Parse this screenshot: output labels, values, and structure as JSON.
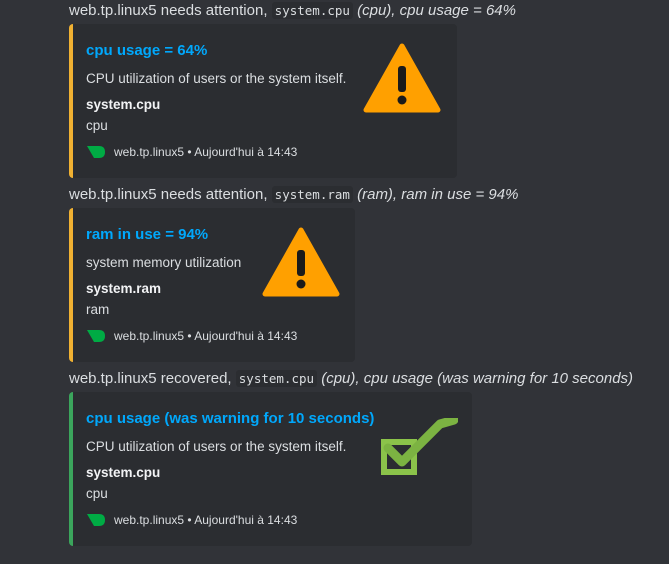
{
  "messages": [
    {
      "host": "web.tp.linux5",
      "verb": "needs attention,",
      "code": "system.cpu",
      "chart": "(cpu),",
      "summary": "cpu usage = 64%",
      "embed": {
        "title": "cpu usage = 64%",
        "description": "CPU utilization of users or the system itself.",
        "field_name": "system.cpu",
        "field_value": "cpu",
        "footer": "web.tp.linux5 • Aujourd'hui à 14:43",
        "icon": "warning-icon",
        "color": "#f0b132"
      }
    },
    {
      "host": "web.tp.linux5",
      "verb": "needs attention,",
      "code": "system.ram",
      "chart": "(ram),",
      "summary": "ram in use = 94%",
      "embed": {
        "title": "ram in use = 94%",
        "description": "system memory utilization",
        "field_name": "system.ram",
        "field_value": "ram",
        "footer": "web.tp.linux5 • Aujourd'hui à 14:43",
        "icon": "warning-icon",
        "color": "#f0b132"
      }
    },
    {
      "host": "web.tp.linux5",
      "verb": "recovered,",
      "code": "system.cpu",
      "chart": "(cpu),",
      "summary": "cpu usage (was warning for 10 seconds)",
      "embed": {
        "title": "cpu usage (was warning for 10 seconds)",
        "description": "CPU utilization of users or the system itself.",
        "field_name": "system.cpu",
        "field_value": "cpu",
        "footer": "web.tp.linux5 • Aujourd'hui à 14:43",
        "icon": "checkmark-icon",
        "color": "#3ba55c"
      }
    }
  ]
}
